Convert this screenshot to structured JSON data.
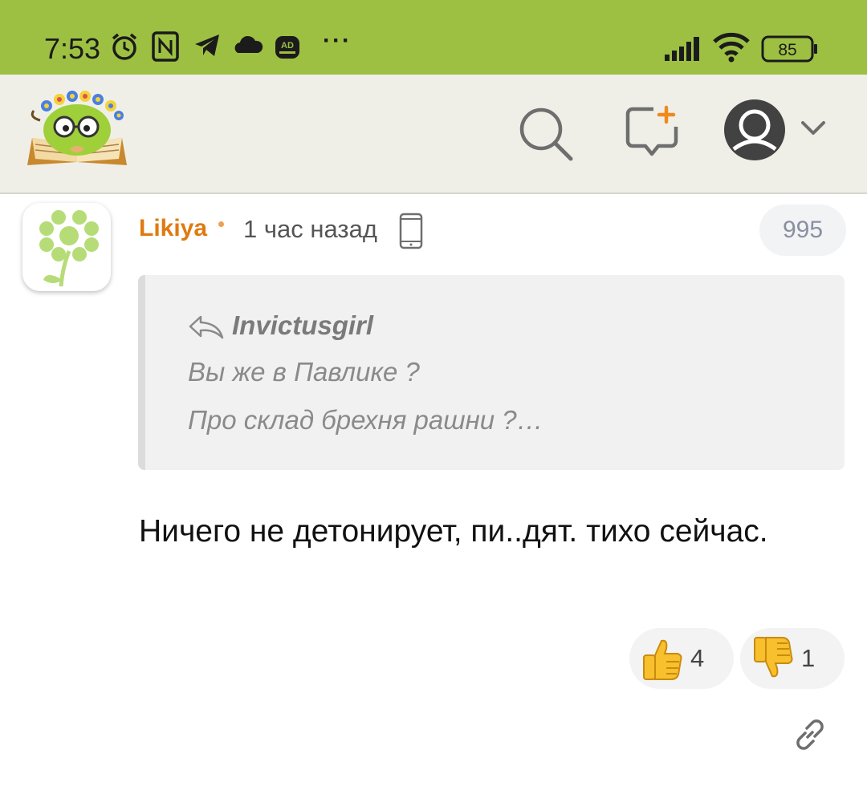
{
  "status_bar": {
    "time": "7:53",
    "battery": "85",
    "more": "···",
    "adblock_label": "AD",
    "background": "#9dc043"
  },
  "header": {
    "logo": "book-worm-logo",
    "icons": [
      "search-icon",
      "new-comment-icon",
      "user-avatar-icon",
      "chevron-down-icon"
    ]
  },
  "comment": {
    "author": "Likiya",
    "time": "1 час назад",
    "device_icon": "phone-icon",
    "count": "995",
    "author_color": "#e07a10",
    "quote": {
      "author": "Invictusgirl",
      "lines": [
        "Вы же в Павлике ?",
        "Про склад брехня рашни ?…"
      ]
    },
    "text": "Ничего не детонирует, пи..дят. тихо сейчас.",
    "likes": "4",
    "dislikes": "1"
  }
}
